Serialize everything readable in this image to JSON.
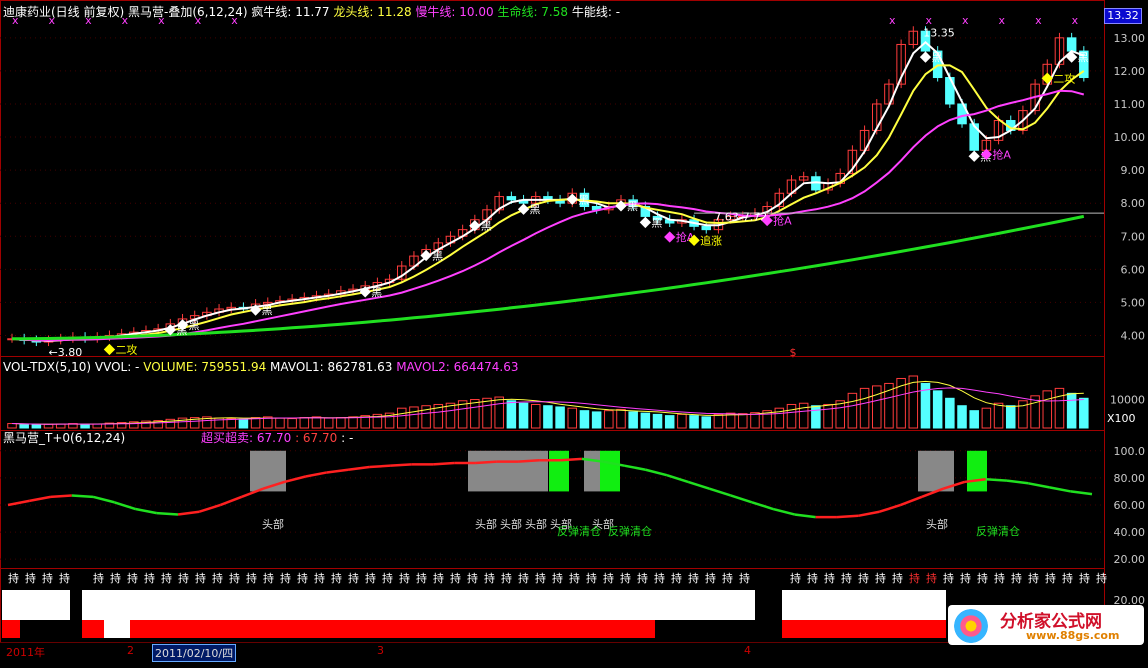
{
  "header": {
    "stock": "迪康药业(日线 前复权)",
    "indicator": "黑马营-叠加(6,12,24)",
    "items": [
      {
        "label": "疯牛线: 11.77",
        "color": "#ffffff"
      },
      {
        "label": "龙头线: 11.28",
        "color": "#ffff40"
      },
      {
        "label": "慢牛线: 10.00",
        "color": "#ff40ff"
      },
      {
        "label": "生命线: 7.58",
        "color": "#20e020"
      },
      {
        "label": "牛能线: -",
        "color": "#ffffff"
      }
    ],
    "price_tag": "13.32"
  },
  "volume_header": {
    "label": "VOL-TDX(5,10)",
    "vvol": "VVOL: -",
    "volume": "VOLUME: 759551.94",
    "mavol1": "MAVOL1: 862781.63",
    "mavol2": "MAVOL2: 664474.63",
    "multiplier": "X100"
  },
  "osc_header": {
    "label": "黑马营_T+0(6,12,24)",
    "title": "超买超卖: 67.70",
    "title2": ": 67.70",
    "title3": ": -"
  },
  "date_bar": {
    "year": "2011年",
    "m2": "2",
    "date_box": "2011/02/10/四",
    "m3": "3",
    "m4": "4"
  },
  "logo": {
    "text": "分析家公式网",
    "url": "www.88gs.com"
  },
  "chart_data": [
    {
      "type": "candlestick",
      "ylim": [
        3.5,
        13.6
      ],
      "ticks": [
        "4.00",
        "5.00",
        "6.00",
        "7.00",
        "8.00",
        "9.00",
        "10.00",
        "11.00",
        "12.00",
        "13.00"
      ],
      "annotations": [
        "←3.80",
        "13.35",
        "7.63-7.72"
      ],
      "markers": [
        {
          "text": "二攻",
          "color": "#ffff00"
        },
        {
          "text": "黑",
          "color": "#ffffff"
        },
        {
          "text": "黑",
          "color": "#ffffff"
        },
        {
          "text": "黑",
          "color": "#ffffff"
        },
        {
          "text": "黑",
          "color": "#ffffff"
        },
        {
          "text": "黑",
          "color": "#ffffff"
        },
        {
          "text": "黑",
          "color": "#ffffff"
        },
        {
          "text": "黑",
          "color": "#ffffff"
        },
        {
          "text": "黑",
          "color": "#ffffff"
        },
        {
          "text": "黑",
          "color": "#ffffff"
        },
        {
          "text": "黑",
          "color": "#ffffff"
        },
        {
          "text": "抢A",
          "color": "#ff40ff"
        },
        {
          "text": "追涨",
          "color": "#ffff00"
        },
        {
          "text": "抢A",
          "color": "#ff40ff"
        },
        {
          "text": "黑",
          "color": "#ffffff"
        },
        {
          "text": "黑",
          "color": "#ffffff"
        },
        {
          "text": "抢A",
          "color": "#ff40ff"
        },
        {
          "text": "二攻",
          "color": "#ffff00"
        },
        {
          "text": "黑",
          "color": "#ffffff"
        }
      ],
      "series": [
        {
          "name": "疯牛线",
          "color": "#ffffff"
        },
        {
          "name": "龙头线",
          "color": "#ffff40"
        },
        {
          "name": "慢牛线",
          "color": "#ff40ff"
        },
        {
          "name": "生命线",
          "color": "#20e020"
        }
      ],
      "closes": [
        3.9,
        3.85,
        3.8,
        3.85,
        3.9,
        3.95,
        3.9,
        3.95,
        4.0,
        4.05,
        4.1,
        4.15,
        4.2,
        4.35,
        4.5,
        4.6,
        4.7,
        4.8,
        4.85,
        4.8,
        4.95,
        5.0,
        5.05,
        5.1,
        5.15,
        5.2,
        5.25,
        5.35,
        5.4,
        5.5,
        5.6,
        5.7,
        6.1,
        6.4,
        6.6,
        6.8,
        7.0,
        7.2,
        7.5,
        7.8,
        8.2,
        8.1,
        8.0,
        8.2,
        8.1,
        8.0,
        8.3,
        7.9,
        7.8,
        7.9,
        8.1,
        7.9,
        7.6,
        7.5,
        7.4,
        7.5,
        7.3,
        7.2,
        7.5,
        7.6,
        7.6,
        7.7,
        7.9,
        8.3,
        8.7,
        8.8,
        8.4,
        8.6,
        8.9,
        9.6,
        10.2,
        11.0,
        11.6,
        12.8,
        13.2,
        12.6,
        11.8,
        11.0,
        10.4,
        9.6,
        9.9,
        10.5,
        10.2,
        10.8,
        11.6,
        12.2,
        13.0,
        12.6,
        11.8
      ]
    },
    {
      "type": "bar",
      "title": "VOL-TDX(5,10)",
      "ticks": [
        "10000"
      ],
      "values": [
        18,
        15,
        14,
        15,
        16,
        18,
        15,
        16,
        20,
        22,
        25,
        28,
        30,
        35,
        40,
        42,
        45,
        40,
        38,
        35,
        42,
        45,
        40,
        38,
        42,
        45,
        40,
        42,
        45,
        50,
        55,
        60,
        80,
        85,
        90,
        95,
        100,
        110,
        115,
        120,
        125,
        110,
        100,
        95,
        90,
        85,
        80,
        70,
        65,
        70,
        75,
        65,
        60,
        55,
        50,
        55,
        50,
        45,
        55,
        60,
        58,
        62,
        70,
        80,
        95,
        100,
        90,
        95,
        110,
        140,
        160,
        170,
        180,
        200,
        210,
        180,
        150,
        120,
        90,
        70,
        80,
        100,
        90,
        110,
        130,
        150,
        160,
        140,
        120
      ]
    },
    {
      "type": "line",
      "title": "黑马营_T+0(6,12,24)",
      "ticks": [
        "20.00",
        "40.00",
        "60.00",
        "80.00",
        "100.0"
      ],
      "ylim": [
        12,
        105
      ],
      "labels": [
        "头部",
        "头部",
        "头部",
        "头部",
        "头部",
        "头部",
        "反弹清仓",
        "反弹清仓",
        "头部",
        "反弹清仓"
      ],
      "values": [
        60,
        63,
        66,
        67,
        66,
        62,
        57,
        54,
        53,
        55,
        60,
        66,
        72,
        77,
        81,
        84,
        86,
        88,
        89,
        90,
        90,
        91,
        91,
        92,
        92,
        93,
        93,
        94,
        92,
        89,
        86,
        82,
        77,
        72,
        67,
        62,
        57,
        53,
        51,
        51,
        52,
        55,
        60,
        66,
        72,
        77,
        79,
        78,
        76,
        73,
        70,
        68
      ],
      "hold_text": "持"
    }
  ]
}
